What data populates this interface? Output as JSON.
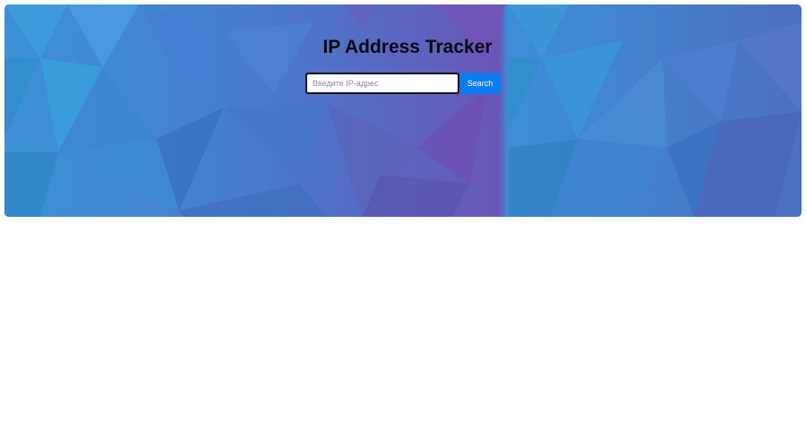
{
  "header": {
    "title": "IP Address Tracker"
  },
  "search": {
    "placeholder": "Введите IP-адрес",
    "value": "",
    "button_label": "Search"
  },
  "colors": {
    "button": "#0a7bf0",
    "hero_blue": "#3d8fd8",
    "hero_purple": "#6a55b8"
  }
}
